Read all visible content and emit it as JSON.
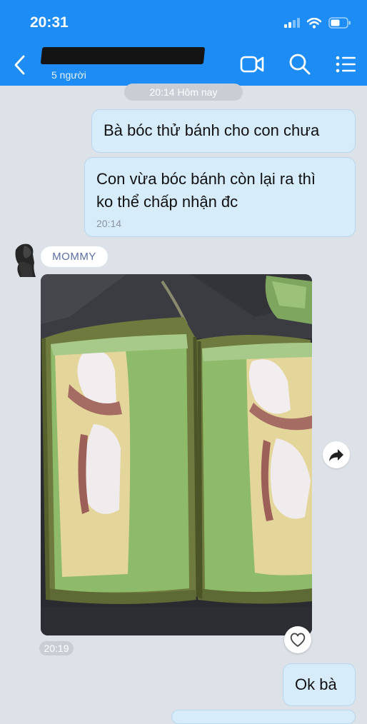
{
  "status_bar": {
    "time": "20:31"
  },
  "header": {
    "member_count": "5 người"
  },
  "chat": {
    "date_separator": "20:14 Hôm nay",
    "messages": [
      {
        "side": "right",
        "text": "Bà bóc thử bánh cho con chưa"
      },
      {
        "side": "right",
        "lines": [
          "Con vừa bóc bánh còn lại ra thì",
          "ko thể chấp nhận đc"
        ],
        "time": "20:14"
      },
      {
        "side": "left",
        "sender": "MOMMY",
        "type": "photo",
        "time": "20:19"
      },
      {
        "side": "right",
        "text": "Ok bà"
      }
    ]
  },
  "colors": {
    "header_bg": "#1d8df5",
    "chat_bg": "#dde2e9",
    "bubble_bg": "#d6ecfb",
    "sender_label": "#5c6ea3"
  },
  "icons": [
    "signal-icon",
    "wifi-icon",
    "battery-icon",
    "back-arrow-icon",
    "video-call-icon",
    "search-icon",
    "menu-list-icon",
    "share-forward-icon",
    "heart-icon"
  ]
}
